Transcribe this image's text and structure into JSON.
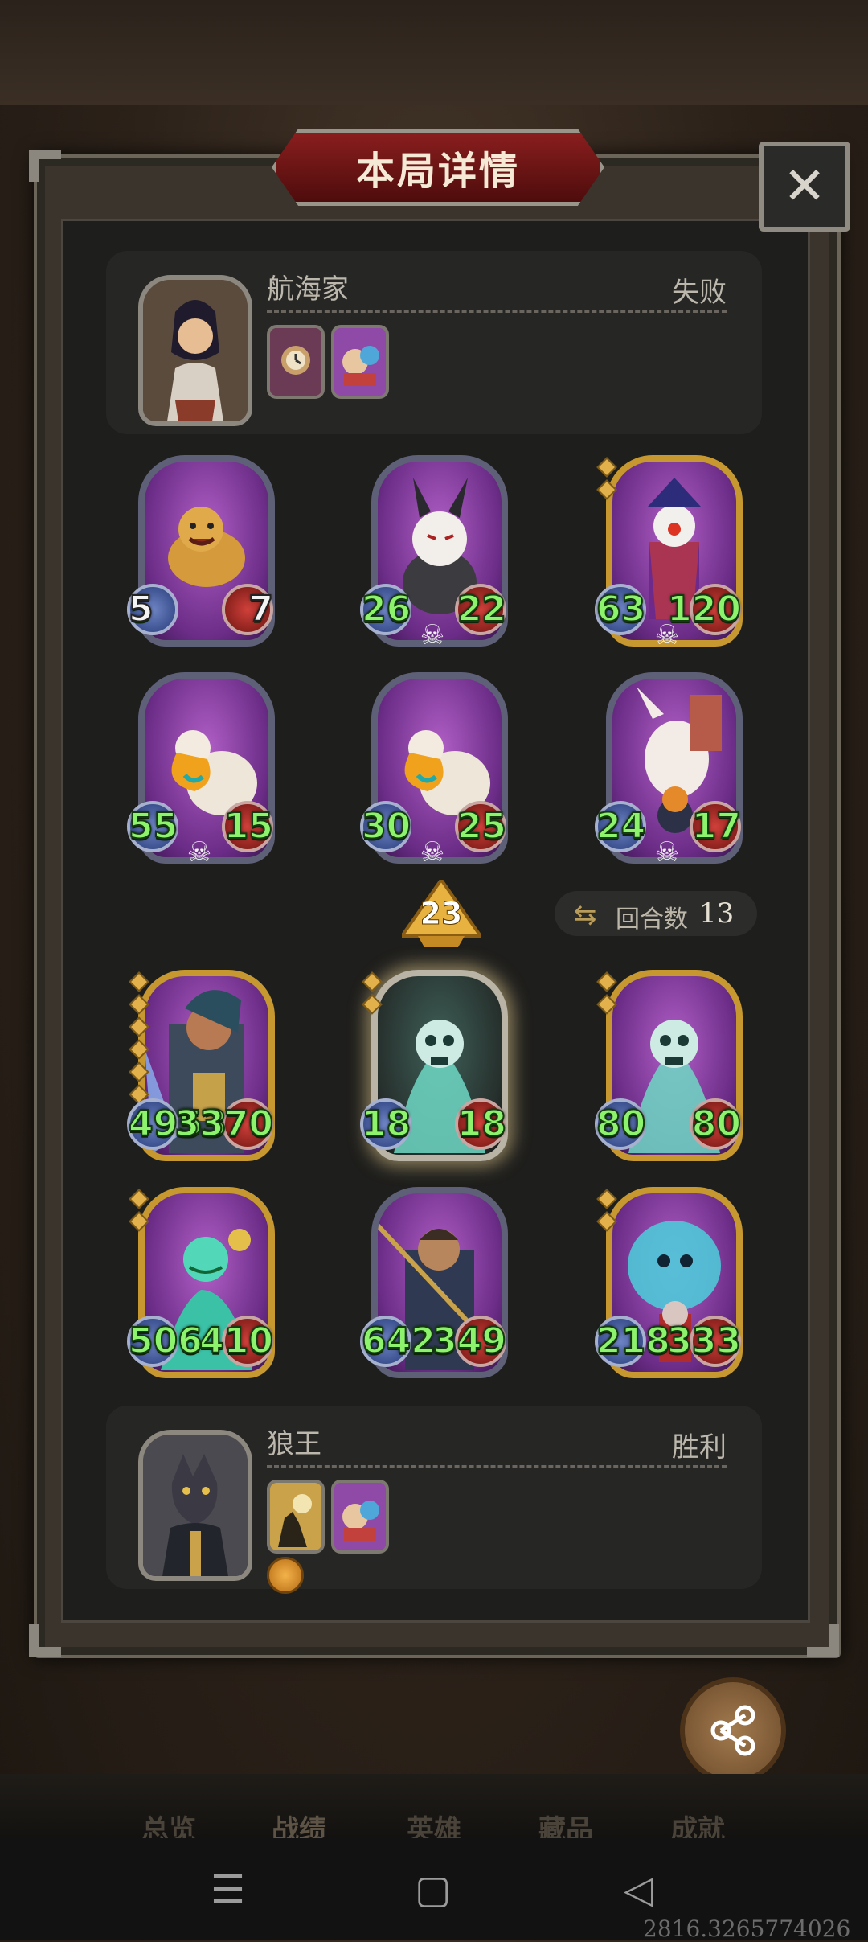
{
  "title": "本局详情",
  "close_label": "✕",
  "top_player": {
    "name": "航海家",
    "result": "失败"
  },
  "bottom_player": {
    "name": "狼王",
    "result": "胜利"
  },
  "enemy_cards": [
    {
      "atk": "5",
      "hp": "7",
      "art": "hyena-icon",
      "frame": "silver",
      "skull": false,
      "white": true
    },
    {
      "atk": "26",
      "hp": "22",
      "art": "masked-bunny-icon",
      "frame": "silver",
      "skull": true,
      "white": false
    },
    {
      "atk": "63",
      "hp": "120",
      "art": "clown-icon",
      "frame": "gold",
      "skull": true,
      "white": false
    },
    {
      "atk": "55",
      "hp": "15",
      "art": "pelican-icon",
      "frame": "silver",
      "skull": true,
      "white": false
    },
    {
      "atk": "30",
      "hp": "25",
      "art": "pelican-icon",
      "frame": "silver",
      "skull": true,
      "white": false
    },
    {
      "atk": "24",
      "hp": "17",
      "art": "rabbit-pumpkin-icon",
      "frame": "silver",
      "skull": true,
      "white": false
    }
  ],
  "tier": "23",
  "round": {
    "label": "回合数",
    "value": "13"
  },
  "ally_cards": [
    {
      "atk": "4953",
      "hp": "3370",
      "art": "warrior-icon",
      "frame": "gold"
    },
    {
      "atk": "18",
      "hp": "18",
      "art": "ghost-skeleton-icon",
      "frame": "glow"
    },
    {
      "atk": "80",
      "hp": "80",
      "art": "ghost-skeleton-icon",
      "frame": "gold"
    },
    {
      "atk": "506",
      "hp": "410",
      "art": "genie-icon",
      "frame": "gold"
    },
    {
      "atk": "642",
      "hp": "349",
      "art": "spearman-icon",
      "frame": "silver"
    },
    {
      "atk": "218",
      "hp": "333",
      "art": "ghost-blob-icon",
      "frame": "gold"
    }
  ],
  "share_label": "分享",
  "tabs": [
    "总览",
    "战绩",
    "英雄",
    "藏品",
    "成就"
  ],
  "coordinate_readout": "2816.3265774026",
  "colors": {
    "stat_green": "#8ef36c",
    "title_red": "#8a1e1e",
    "gold_frame": "#c6982f"
  }
}
